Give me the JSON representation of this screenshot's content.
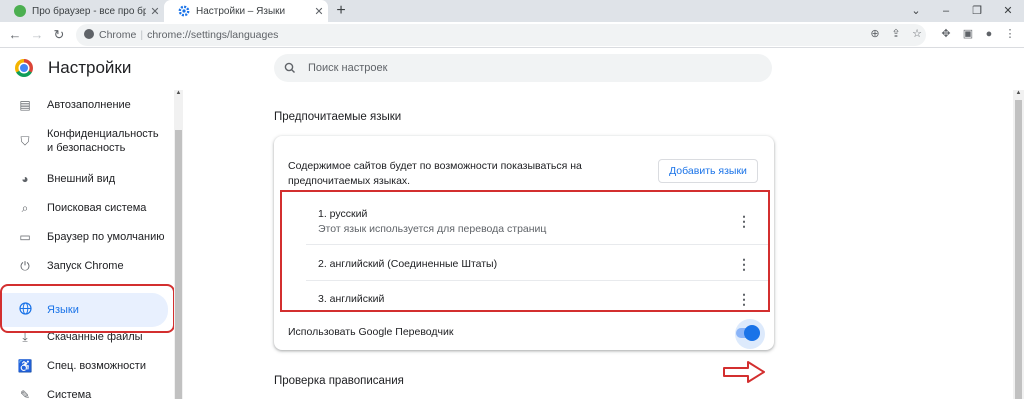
{
  "tabs": [
    {
      "title": "Про браузер - все про браузеры",
      "favicon_color": "#4caf50",
      "active": false
    },
    {
      "title": "Настройки – Языки",
      "favicon_color": "#1a73e8",
      "active": true
    }
  ],
  "window_controls": {
    "dropdown": "⌄",
    "minimize": "–",
    "maximize": "❐",
    "close": "✕"
  },
  "address_bar": {
    "site_label": "Chrome",
    "url": "chrome://settings/languages"
  },
  "settings": {
    "title": "Настройки",
    "search_placeholder": "Поиск настроек"
  },
  "sidebar": {
    "items": [
      {
        "label": "Автозаполнение",
        "icon": "clipboard-icon"
      },
      {
        "label": "Конфиденциальность и безопасность",
        "icon": "shield-icon"
      },
      {
        "label": "Внешний вид",
        "icon": "palette-icon"
      },
      {
        "label": "Поисковая система",
        "icon": "search-icon"
      },
      {
        "label": "Браузер по умолчанию",
        "icon": "browser-icon"
      },
      {
        "label": "Запуск Chrome",
        "icon": "power-icon"
      },
      {
        "label": "Языки",
        "icon": "globe-icon",
        "active": true
      },
      {
        "label": "Скачанные файлы",
        "icon": "download-icon"
      },
      {
        "label": "Спец. возможности",
        "icon": "accessibility-icon"
      },
      {
        "label": "Система",
        "icon": "wrench-icon"
      }
    ]
  },
  "languages": {
    "section_title": "Предпочитаемые языки",
    "description": "Содержимое сайтов будет по возможности показываться на предпочитаемых языках.",
    "add_button": "Добавить языки",
    "items": [
      {
        "label": "1. русский",
        "sublabel": "Этот язык используется для перевода страниц"
      },
      {
        "label": "2. английский (Соединенные Штаты)"
      },
      {
        "label": "3. английский"
      }
    ],
    "translate_label": "Использовать Google Переводчик",
    "translate_enabled": true
  },
  "spellcheck": {
    "section_title": "Проверка правописания"
  },
  "colors": {
    "accent": "#1a73e8",
    "highlight": "#d32f2f",
    "active_bg": "#e8f0fe"
  }
}
